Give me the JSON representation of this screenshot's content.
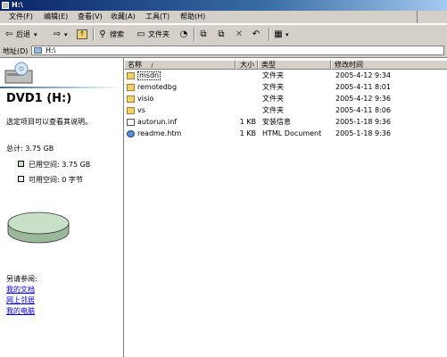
{
  "window": {
    "title": "H:\\"
  },
  "menu": {
    "items": [
      {
        "label": "文件(F)"
      },
      {
        "label": "编辑(E)"
      },
      {
        "label": "查看(V)"
      },
      {
        "label": "收藏(A)"
      },
      {
        "label": "工具(T)"
      },
      {
        "label": "帮助(H)"
      }
    ]
  },
  "toolbar": {
    "back_label": "后退",
    "search_label": "搜索",
    "folders_label": "文件夹"
  },
  "address": {
    "label": "地址(D)",
    "value": "H:\\"
  },
  "left": {
    "drive_title": "DVD1 (H:)",
    "hint": "选定项目可以查看其说明。",
    "total": "总计: 3.75 GB",
    "used": "已用空间: 3.75 GB",
    "free": "可用空间: 0 字节",
    "see_also": "另请参阅:",
    "links": [
      "我的文档",
      "网上邻居",
      "我的电脑"
    ],
    "used_color": "#c8e0c8",
    "free_color": "#ffffff"
  },
  "columns": {
    "name": "名称",
    "size": "大小",
    "type": "类型",
    "modified": "修改时间"
  },
  "files": [
    {
      "name": "msdn",
      "size": "",
      "type": "文件夹",
      "modified": "2005-4-12 9:34",
      "icon": "folder-icon"
    },
    {
      "name": "remotedbg",
      "size": "",
      "type": "文件夹",
      "modified": "2005-4-11 8:01",
      "icon": "folder-icon"
    },
    {
      "name": "visio",
      "size": "",
      "type": "文件夹",
      "modified": "2005-4-12 9:36",
      "icon": "folder-icon"
    },
    {
      "name": "vs",
      "size": "",
      "type": "文件夹",
      "modified": "2005-4-11 8:06",
      "icon": "folder-icon"
    },
    {
      "name": "autorun.inf",
      "size": "1 KB",
      "type": "安装信息",
      "modified": "2005-1-18 9:36",
      "icon": "document-icon"
    },
    {
      "name": "readme.htm",
      "size": "1 KB",
      "type": "HTML Document",
      "modified": "2005-1-18 9:36",
      "icon": "html-icon"
    }
  ]
}
